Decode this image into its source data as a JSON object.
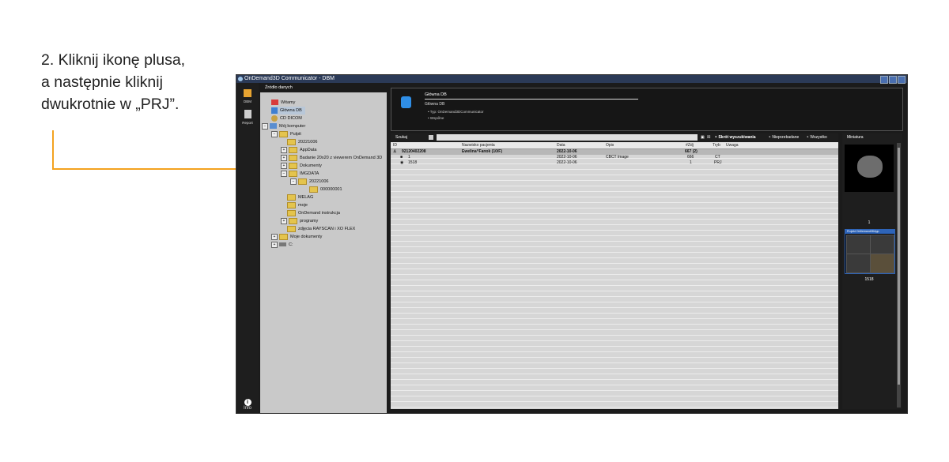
{
  "instruction": {
    "text": "2. Kliknij ikonę plusa,\na następnie kliknij\ndwukrotnie w „PRJ”."
  },
  "window": {
    "title": "OnDemand3D Communicator - DBM"
  },
  "left_nav": {
    "items": [
      {
        "label": "DBM",
        "icon": "database-icon"
      },
      {
        "label": "Report",
        "icon": "report-icon"
      }
    ],
    "info_label": "Info"
  },
  "tree": {
    "header": "Źródło danych",
    "items": [
      {
        "label": "Witamy"
      },
      {
        "label": "Główna DB"
      },
      {
        "label": "CD DICOM"
      },
      {
        "label": "Mój komputer"
      },
      {
        "label": "Pulpit"
      },
      {
        "label": "20221006"
      },
      {
        "label": "AppData"
      },
      {
        "label": "Badanie 20x20 z viewerem OnDemand 3D"
      },
      {
        "label": "Dokumenty"
      },
      {
        "label": "IMGDATA"
      },
      {
        "label": "20221006"
      },
      {
        "label": "000000001"
      },
      {
        "label": "MELAG"
      },
      {
        "label": "moje"
      },
      {
        "label": "OnDemand instrukcja"
      },
      {
        "label": "programy"
      },
      {
        "label": "zdjęcia RAYSCAN i XO FLEX"
      },
      {
        "label": "Moje dokumenty"
      },
      {
        "label": "C:"
      }
    ]
  },
  "db_panel": {
    "title": "Główna DB",
    "subtitle": "Główna DB",
    "bullet1": "Typ: OnDemand3DCommunicator",
    "bullet2": "Wspólne"
  },
  "search": {
    "label": "Szukaj",
    "quick_label": "Skrót wyszukiwania",
    "unread_label": "Nieprzebadane",
    "all_label": "Wszystko"
  },
  "grid": {
    "columns": [
      "ID",
      "Nazwisko pacjenta",
      "Data",
      "Opis",
      "#Zdj",
      "Tryb",
      "Uwaga"
    ],
    "rows": [
      [
        "92120402208",
        "Ewelina^Fanok (10/F)",
        "2022-10-06",
        "",
        "667 (2)",
        "",
        ""
      ],
      [
        "1",
        "",
        "2022-10-06",
        "CBCT Image",
        "666",
        "CT",
        ""
      ],
      [
        "1518",
        "",
        "2022-10-06",
        "",
        "1",
        "PRJ",
        ""
      ]
    ]
  },
  "thumbs": {
    "header": "Miniatura",
    "items": [
      {
        "label": "1"
      },
      {
        "label": "1518",
        "bar": "Projekt OnDemand3DApp"
      }
    ]
  },
  "colors": {
    "accent": "#f3a21f",
    "window_bg": "#1b1b1b",
    "titlebar": "#2b3a57",
    "tree_bg": "#c9c9c9"
  }
}
